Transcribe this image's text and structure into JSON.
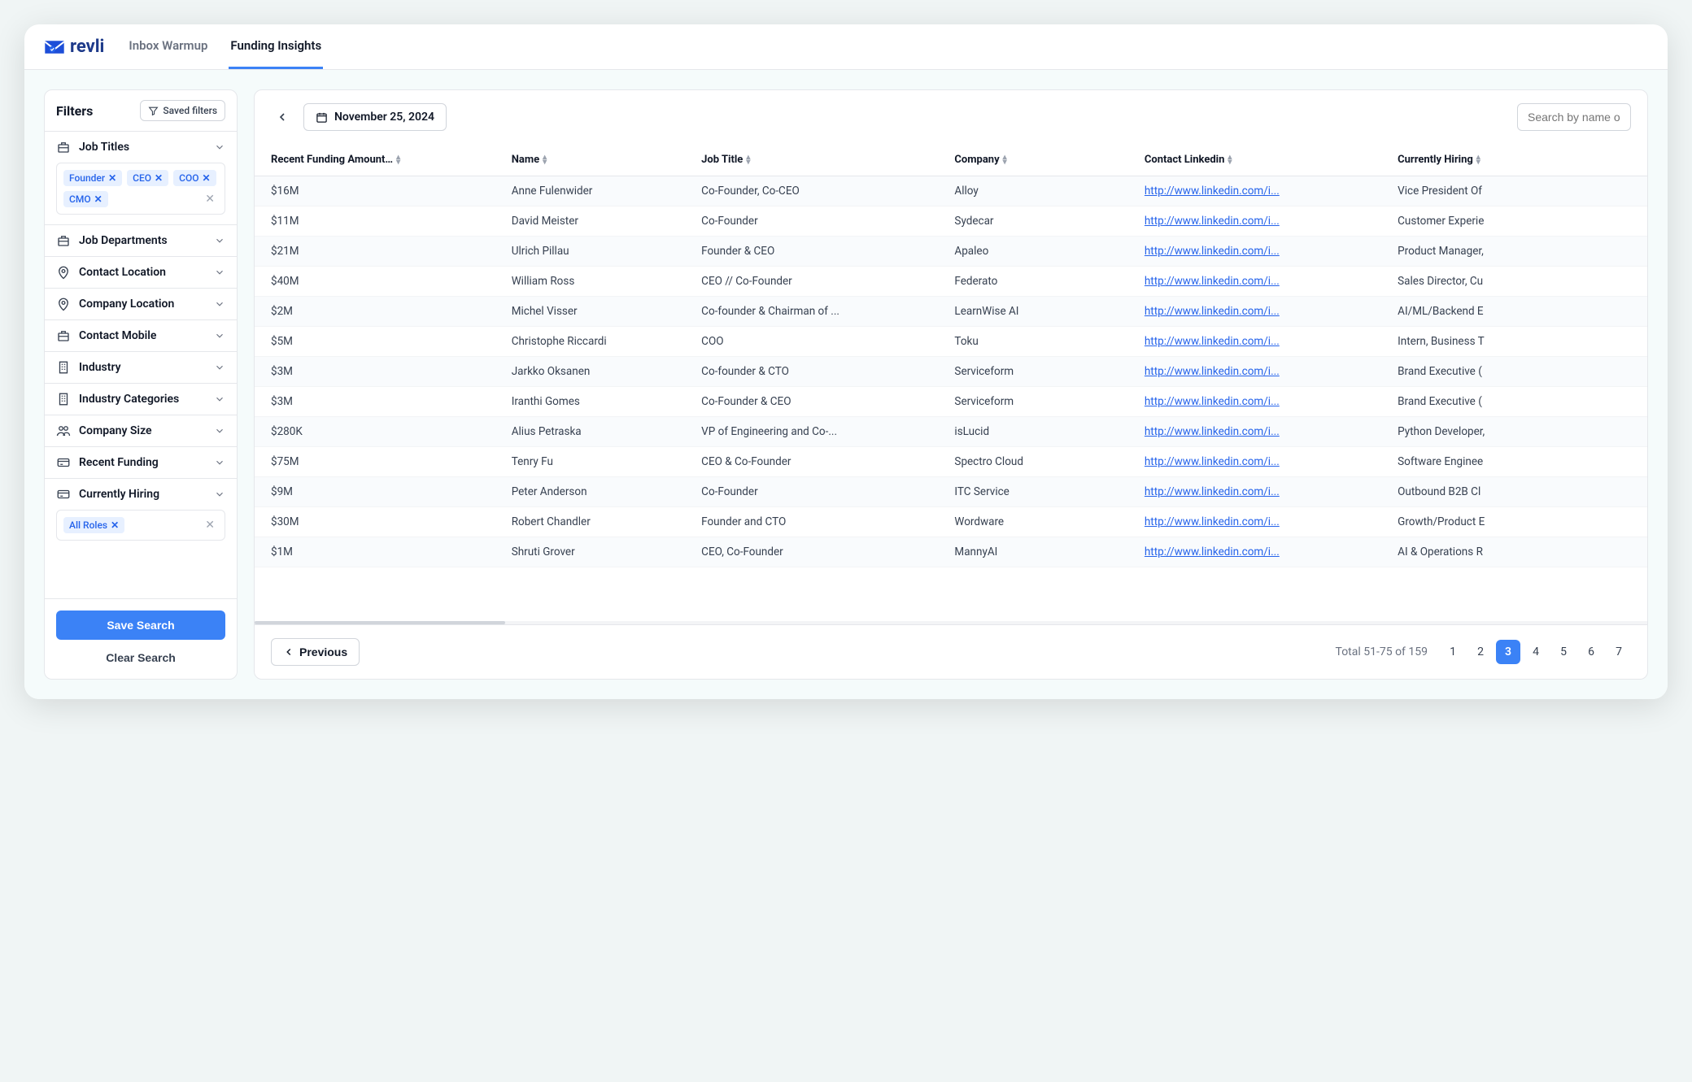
{
  "brand": "revli",
  "nav": {
    "inbox": "Inbox Warmup",
    "funding": "Funding Insights"
  },
  "sidebar": {
    "title": "Filters",
    "saved": "Saved filters",
    "sections": [
      {
        "label": "Job Titles",
        "chips": [
          "Founder",
          "CEO",
          "COO",
          "CMO"
        ]
      },
      {
        "label": "Job Departments"
      },
      {
        "label": "Contact Location"
      },
      {
        "label": "Company Location"
      },
      {
        "label": "Contact Mobile"
      },
      {
        "label": "Industry"
      },
      {
        "label": "Industry Categories"
      },
      {
        "label": "Company Size"
      },
      {
        "label": "Recent Funding"
      },
      {
        "label": "Currently Hiring",
        "chips": [
          "All Roles"
        ]
      }
    ],
    "save_btn": "Save Search",
    "clear_btn": "Clear Search"
  },
  "toolbar": {
    "date": "November 25, 2024",
    "search_placeholder": "Search by name or"
  },
  "columns": [
    "Recent Funding Amount…",
    "Name",
    "Job Title",
    "Company",
    "Contact Linkedin",
    "Currently Hiring"
  ],
  "rows": [
    {
      "amt": "$16M",
      "name": "Anne Fulenwider",
      "title": "Co-Founder, Co-CEO",
      "company": "Alloy",
      "link": "http://www.linkedin.com/i...",
      "hiring": "Vice President Of"
    },
    {
      "amt": "$11M",
      "name": "David Meister",
      "title": "Co-Founder",
      "company": "Sydecar",
      "link": "http://www.linkedin.com/i...",
      "hiring": "Customer Experie"
    },
    {
      "amt": "$21M",
      "name": "Ulrich Pillau",
      "title": "Founder & CEO",
      "company": "Apaleo",
      "link": "http://www.linkedin.com/i...",
      "hiring": "Product Manager,"
    },
    {
      "amt": "$40M",
      "name": "William Ross",
      "title": "CEO // Co-Founder",
      "company": "Federato",
      "link": "http://www.linkedin.com/i...",
      "hiring": "Sales Director, Cu"
    },
    {
      "amt": "$2M",
      "name": "Michel Visser",
      "title": "Co-founder & Chairman of ...",
      "company": "LearnWise AI",
      "link": "http://www.linkedin.com/i...",
      "hiring": "AI/ML/Backend E"
    },
    {
      "amt": "$5M",
      "name": "Christophe Riccardi",
      "title": "COO",
      "company": "Toku",
      "link": "http://www.linkedin.com/i...",
      "hiring": "Intern, Business T"
    },
    {
      "amt": "$3M",
      "name": "Jarkko Oksanen",
      "title": "Co-founder & CTO",
      "company": "Serviceform",
      "link": "http://www.linkedin.com/i...",
      "hiring": "Brand Executive ("
    },
    {
      "amt": "$3M",
      "name": "Iranthi Gomes",
      "title": "Co-Founder & CEO",
      "company": "Serviceform",
      "link": "http://www.linkedin.com/i...",
      "hiring": "Brand Executive ("
    },
    {
      "amt": "$280K",
      "name": "Alius Petraska",
      "title": "VP of Engineering and Co-...",
      "company": "isLucid",
      "link": "http://www.linkedin.com/i...",
      "hiring": "Python Developer,"
    },
    {
      "amt": "$75M",
      "name": "Tenry Fu",
      "title": "CEO & Co-Founder",
      "company": "Spectro Cloud",
      "link": "http://www.linkedin.com/i...",
      "hiring": "Software Enginee"
    },
    {
      "amt": "$9M",
      "name": "Peter Anderson",
      "title": "Co-Founder",
      "company": "ITC Service",
      "link": "http://www.linkedin.com/i...",
      "hiring": "Outbound B2B Cl"
    },
    {
      "amt": "$30M",
      "name": "Robert Chandler",
      "title": "Founder and CTO",
      "company": "Wordware",
      "link": "http://www.linkedin.com/i...",
      "hiring": "Growth/Product E"
    },
    {
      "amt": "$1M",
      "name": "Shruti Grover",
      "title": "CEO, Co-Founder",
      "company": "MannyAI",
      "link": "http://www.linkedin.com/i...",
      "hiring": "AI & Operations R"
    }
  ],
  "footer": {
    "prev": "Previous",
    "total": "Total 51-75 of 159",
    "pages": [
      1,
      2,
      3,
      4,
      5,
      6,
      7
    ],
    "active_page": 3
  }
}
